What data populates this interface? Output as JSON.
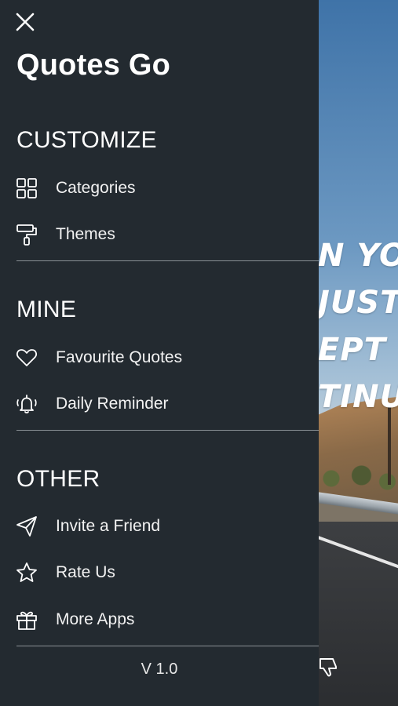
{
  "drawer": {
    "app_title": "Quotes Go",
    "version": "V 1.0",
    "sections": [
      {
        "title": "CUSTOMIZE",
        "items": [
          {
            "label": "Categories",
            "icon": "grid-icon"
          },
          {
            "label": "Themes",
            "icon": "paint-roller-icon"
          }
        ]
      },
      {
        "title": "MINE",
        "items": [
          {
            "label": "Favourite Quotes",
            "icon": "heart-icon"
          },
          {
            "label": "Daily Reminder",
            "icon": "bell-ringing-icon"
          }
        ]
      },
      {
        "title": "OTHER",
        "items": [
          {
            "label": "Invite a Friend",
            "icon": "paper-plane-icon"
          },
          {
            "label": "Rate Us",
            "icon": "star-icon"
          },
          {
            "label": "More Apps",
            "icon": "gift-icon"
          }
        ]
      }
    ]
  },
  "background_quote": {
    "lines": [
      "N YOU",
      "JUST",
      "EPT",
      "TINUE"
    ]
  },
  "colors": {
    "drawer_bg": "#232a30",
    "text": "#ffffff",
    "divider": "#8a9095"
  }
}
